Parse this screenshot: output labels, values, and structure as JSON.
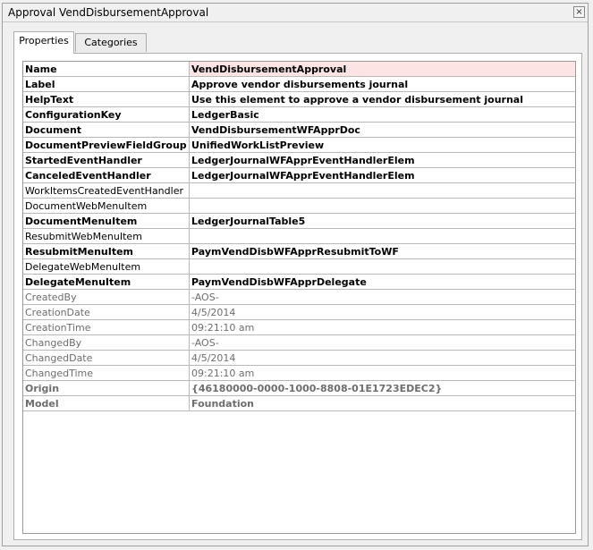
{
  "window": {
    "title": "Approval VendDisbursementApproval",
    "close_glyph": "×"
  },
  "tabs": [
    {
      "label": "Properties",
      "active": true
    },
    {
      "label": "Categories",
      "active": false
    }
  ],
  "properties": [
    {
      "name": "Name",
      "value": "VendDisbursementApproval",
      "style": "bold",
      "selected": true
    },
    {
      "name": "Label",
      "value": "Approve vendor disbursements journal",
      "style": "bold"
    },
    {
      "name": "HelpText",
      "value": "Use this element to approve a vendor disbursement journal",
      "style": "bold"
    },
    {
      "name": "ConfigurationKey",
      "value": "LedgerBasic",
      "style": "bold"
    },
    {
      "name": "Document",
      "value": "VendDisbursementWFApprDoc",
      "style": "bold"
    },
    {
      "name": "DocumentPreviewFieldGroup",
      "value": "UnifiedWorkListPreview",
      "style": "bold"
    },
    {
      "name": "StartedEventHandler",
      "value": "LedgerJournalWFApprEventHandlerElem",
      "style": "bold"
    },
    {
      "name": "CanceledEventHandler",
      "value": "LedgerJournalWFApprEventHandlerElem",
      "style": "bold"
    },
    {
      "name": "WorkItemsCreatedEventHandler",
      "value": "",
      "style": "normal"
    },
    {
      "name": "DocumentWebMenuItem",
      "value": "",
      "style": "normal"
    },
    {
      "name": "DocumentMenuItem",
      "value": "LedgerJournalTable5",
      "style": "bold"
    },
    {
      "name": "ResubmitWebMenuItem",
      "value": "",
      "style": "normal"
    },
    {
      "name": "ResubmitMenuItem",
      "value": "PaymVendDisbWFApprResubmitToWF",
      "style": "bold"
    },
    {
      "name": "DelegateWebMenuItem",
      "value": "",
      "style": "normal"
    },
    {
      "name": "DelegateMenuItem",
      "value": "PaymVendDisbWFApprDelegate",
      "style": "bold"
    },
    {
      "name": "CreatedBy",
      "value": "-AOS-",
      "style": "readonly"
    },
    {
      "name": "CreationDate",
      "value": "4/5/2014",
      "style": "readonly"
    },
    {
      "name": "CreationTime",
      "value": "09:21:10 am",
      "style": "readonly"
    },
    {
      "name": "ChangedBy",
      "value": "-AOS-",
      "style": "readonly"
    },
    {
      "name": "ChangedDate",
      "value": "4/5/2014",
      "style": "readonly"
    },
    {
      "name": "ChangedTime",
      "value": "09:21:10 am",
      "style": "readonly"
    },
    {
      "name": "Origin",
      "value": "{46180000-0000-1000-8808-01E1723EDEC2}",
      "style": "readonly-bold"
    },
    {
      "name": "Model",
      "value": "Foundation",
      "style": "readonly-bold"
    }
  ],
  "colors": {
    "selected_value_bg": "#fde4e4",
    "readonly_text": "#6d6d6d"
  }
}
